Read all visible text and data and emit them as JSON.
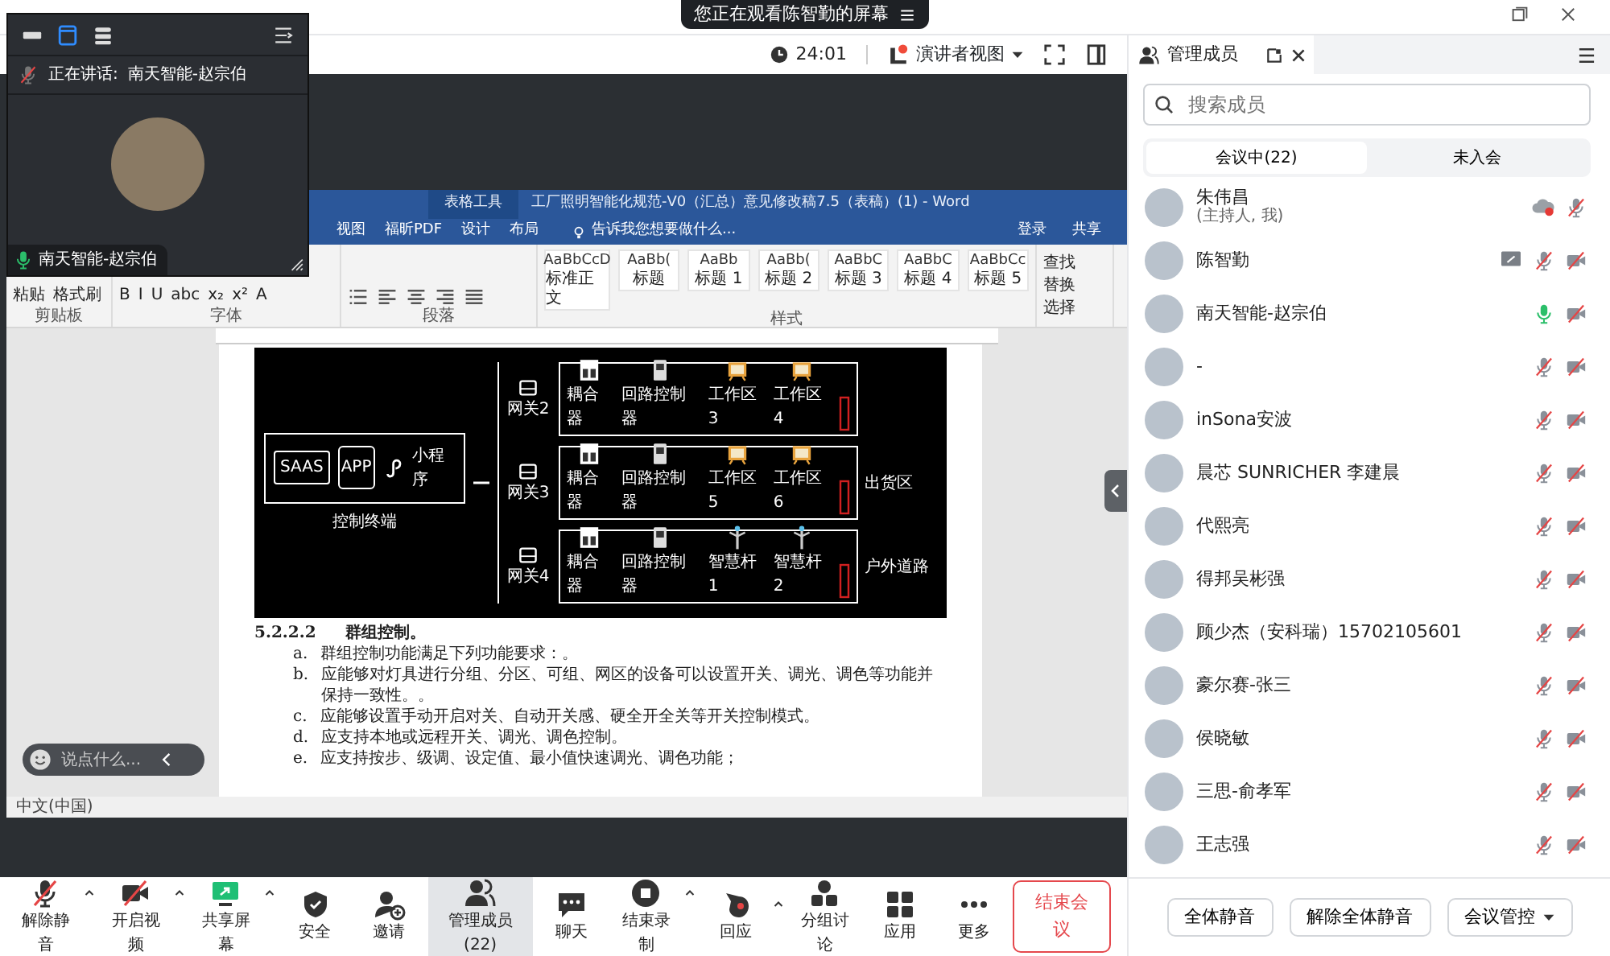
{
  "top_bar": {
    "banner": "您正在观看陈智勤的屏幕"
  },
  "toolbar": {
    "timer": "24:01",
    "view_mode": "演讲者视图",
    "view_mode_notice": true
  },
  "floating_video": {
    "self_mic_muted": true,
    "speaking_label": "正在讲话:",
    "speaker": "南天智能-赵宗伯",
    "name_tag": "南天智能-赵宗伯",
    "speaker_talking": true
  },
  "shared_screen": {
    "context_tab": "表格工具",
    "title": "工厂照明智能化规范-V0（汇总）意见修改稿7.5（表稿）(1) - Word",
    "ribbon_tabs": [
      "视图",
      "福昕PDF",
      "设计",
      "布局"
    ],
    "tell_me": "告诉我您想要做什么...",
    "account": [
      "登录",
      "共享"
    ],
    "clipboard": {
      "label": "剪贴板",
      "items": [
        "粘贴",
        "格式刷"
      ]
    },
    "font": {
      "label": "字体",
      "items": [
        "B",
        "I",
        "U",
        "abc",
        "x₂",
        "x²",
        "A"
      ]
    },
    "paragraph": {
      "label": "段落"
    },
    "styles": {
      "label": "样式",
      "items": [
        {
          "sample": "AaBbCcD",
          "name": "标准正文"
        },
        {
          "sample": "AaBb(",
          "name": "标题"
        },
        {
          "sample": "AaBb",
          "name": "标题 1"
        },
        {
          "sample": "AaBb(",
          "name": "标题 2"
        },
        {
          "sample": "AaBbC",
          "name": "标题 3"
        },
        {
          "sample": "AaBbC",
          "name": "标题 4"
        },
        {
          "sample": "AaBbCc",
          "name": "标题 5"
        }
      ]
    },
    "editing": [
      "查找",
      "替换",
      "选择"
    ],
    "diagram": {
      "terminal": [
        {
          "kind": "monitor",
          "label": "SAAS"
        },
        {
          "kind": "phone",
          "label": "APP"
        },
        {
          "kind": "miniapp",
          "label": "小程序"
        }
      ],
      "terminal_caption": "控制终端",
      "rows": [
        {
          "gateway": "网关2",
          "devices": [
            {
              "kind": "coupler",
              "label": "耦合器"
            },
            {
              "kind": "controller",
              "label": "回路控制器"
            },
            {
              "kind": "lamp",
              "label": "工作区3"
            },
            {
              "kind": "lamp",
              "label": "工作区4"
            }
          ]
        },
        {
          "gateway": "网关3",
          "devices": [
            {
              "kind": "coupler",
              "label": "耦合器"
            },
            {
              "kind": "controller",
              "label": "回路控制器"
            },
            {
              "kind": "lamp",
              "label": "工作区5"
            },
            {
              "kind": "lamp",
              "label": "工作区6"
            }
          ],
          "area": "出货区"
        },
        {
          "gateway": "网关4",
          "devices": [
            {
              "kind": "coupler",
              "label": "耦合器"
            },
            {
              "kind": "controller",
              "label": "回路控制器"
            },
            {
              "kind": "pole",
              "label": "智慧杆1"
            },
            {
              "kind": "pole",
              "label": "智慧杆2"
            }
          ],
          "area": "户外道路"
        }
      ]
    },
    "paragraphs": [
      {
        "kind": "heading",
        "marker": "5.2.2.2",
        "text": "群组控制。"
      },
      {
        "kind": "item",
        "marker": "a.",
        "text": "群组控制功能满足下列功能要求：。"
      },
      {
        "kind": "item",
        "marker": "b.",
        "text": "应能够对灯具进行分组、分区、可组、网区的设备可以设置开关、调光、调色等功能并保持一致性。。"
      },
      {
        "kind": "item",
        "marker": "c.",
        "text": "应能够设置手动开启对关、自动开关感、硬全开全关等开关控制模式。"
      },
      {
        "kind": "item",
        "marker": "d.",
        "text": "应支持本地或远程开关、调光、调色控制。"
      },
      {
        "kind": "item",
        "marker": "e.",
        "text": "应支持按步、级调、设定值、最小值快速调光、调色功能；"
      }
    ],
    "status": "中文(中国)"
  },
  "chat_input": {
    "placeholder": "说点什么..."
  },
  "members_panel": {
    "title": "管理成员",
    "search": {
      "placeholder": "搜索成员"
    },
    "tabs": [
      {
        "label": "会议中(22)",
        "selected": true
      },
      {
        "label": "未入会",
        "selected": false
      }
    ],
    "members": [
      {
        "name": "朱伟昌",
        "note": "(主持人, 我)",
        "recording": true,
        "muted": true
      },
      {
        "name": "陈智勤",
        "sharing": true,
        "muted": true,
        "video_off": true
      },
      {
        "name": "南天智能-赵宗伯",
        "muted": false,
        "video_off": true
      },
      {
        "name": "-",
        "muted": true,
        "video_off": true
      },
      {
        "name": "inSona安波",
        "muted": true,
        "video_off": true
      },
      {
        "name": "晨芯 SUNRICHER 李建晨",
        "muted": true,
        "video_off": true
      },
      {
        "name": "代熙亮",
        "muted": true,
        "video_off": true
      },
      {
        "name": "得邦吴彬强",
        "muted": true,
        "video_off": true
      },
      {
        "name": "顾少杰（安科瑞）15702105601",
        "muted": true,
        "video_off": true
      },
      {
        "name": "豪尔赛-张三",
        "muted": true,
        "video_off": true
      },
      {
        "name": "侯晓敏",
        "muted": true,
        "video_off": true
      },
      {
        "name": "三思-俞孝军",
        "muted": true,
        "video_off": true
      },
      {
        "name": "王志强",
        "muted": true,
        "video_off": true
      }
    ],
    "buttons": [
      "全体静音",
      "解除全体静音"
    ],
    "control_menu": "会议管控"
  },
  "bottom_toolbar": {
    "items": [
      {
        "kind": "mic",
        "label": "解除静音",
        "crossed": true,
        "caret": true,
        "selected": false
      },
      {
        "kind": "video",
        "label": "开启视频",
        "crossed": true,
        "caret": true,
        "selected": false
      },
      {
        "kind": "share",
        "label": "共享屏幕",
        "caret": true,
        "selected": false
      },
      {
        "kind": "shield",
        "label": "安全",
        "caret": false,
        "selected": false
      },
      {
        "kind": "invite",
        "label": "邀请",
        "caret": false,
        "selected": false
      },
      {
        "kind": "members",
        "label": "管理成员(22)",
        "caret": false,
        "selected": true
      },
      {
        "kind": "chat",
        "label": "聊天",
        "caret": false,
        "selected": false
      },
      {
        "kind": "record",
        "label": "结束录制",
        "caret": true,
        "selected": false
      },
      {
        "kind": "reaction",
        "label": "回应",
        "caret": true,
        "selected": false
      },
      {
        "kind": "breakout",
        "label": "分组讨论",
        "caret": false,
        "selected": false
      },
      {
        "kind": "apps",
        "label": "应用",
        "caret": false,
        "selected": false
      },
      {
        "kind": "more",
        "label": "更多",
        "caret": false,
        "selected": false
      }
    ],
    "end_button": "结束会议"
  }
}
